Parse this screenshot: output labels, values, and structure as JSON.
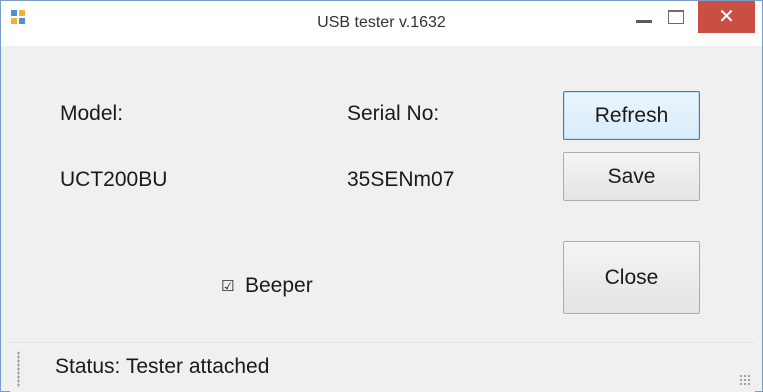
{
  "window": {
    "title": "USB tester v.1632",
    "controls": {
      "minimize": "–",
      "maximize": "☐",
      "close": "✕"
    },
    "accent_close": "#c94f43"
  },
  "fields": {
    "model_label": "Model:",
    "model_value": "UCT200BU",
    "serial_label": "Serial No:",
    "serial_value": "35SENm07"
  },
  "buttons": {
    "refresh": "Refresh",
    "save": "Save",
    "close": "Close"
  },
  "beeper": {
    "label": "Beeper",
    "checked": true,
    "check_glyph": "☑"
  },
  "status": {
    "text": "Status: Tester attached"
  },
  "icons": [
    "app-icon",
    "minimize-icon",
    "maximize-icon",
    "close-icon",
    "size-grip-icon"
  ]
}
